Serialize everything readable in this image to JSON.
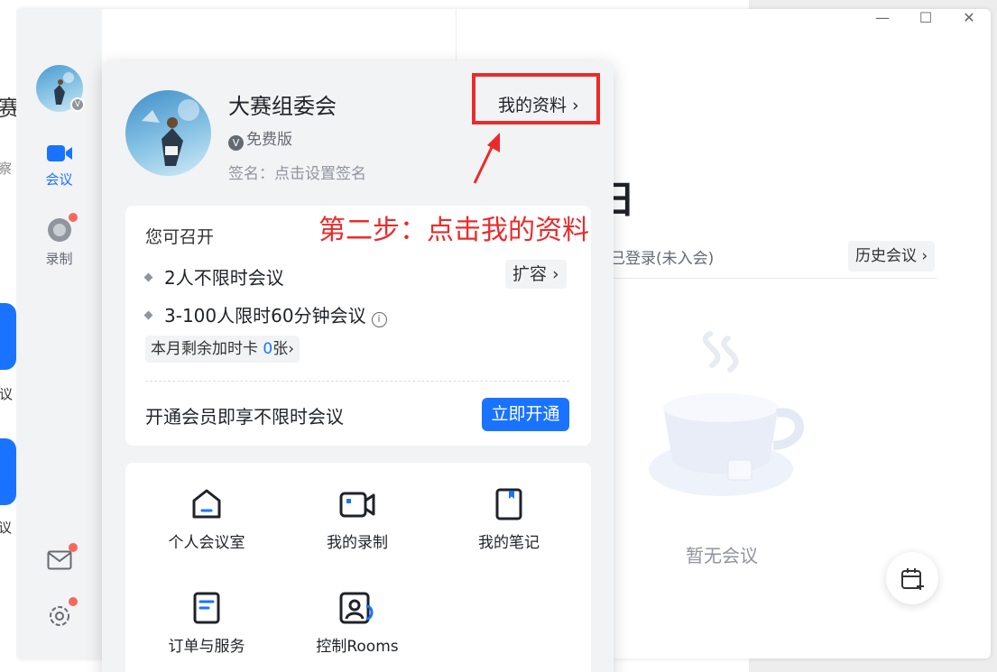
{
  "window": {
    "minimize_glyph": "—",
    "maximize_glyph": "☐",
    "close_glyph": "✕"
  },
  "left_edge": {
    "texts": [
      "赛",
      "察",
      "会议",
      "议"
    ]
  },
  "sidebar": {
    "items": [
      {
        "label": "会议",
        "icon": "video-camera-icon",
        "active": true
      },
      {
        "label": "录制",
        "icon": "record-icon",
        "active": false
      }
    ],
    "bottom_icons": [
      "mail-icon",
      "settings-gear-icon"
    ],
    "accent_color": "#1a73ff",
    "dot_color": "#f7685b"
  },
  "main": {
    "day_label": "日",
    "login_status": "已登录(未入会)",
    "history_button": "历史会议",
    "empty_text": "暂无会议"
  },
  "profile": {
    "name": "大赛组委会",
    "plan": "免费版",
    "signature": "签名：点击设置签名",
    "my_profile_link": "我的资料"
  },
  "benefits": {
    "title": "您可召开",
    "row1": "2人不限时会议",
    "row2": "3-100人限时60分钟会议",
    "expand_button": "扩容",
    "card_prefix": "本月剩余加时卡",
    "card_count": "0",
    "card_suffix": "张",
    "member_text": "开通会员即享不限时会议",
    "open_button": "立即开通"
  },
  "shortcuts": [
    {
      "label": "个人会议室",
      "icon": "personal-room-icon"
    },
    {
      "label": "我的录制",
      "icon": "recording-icon"
    },
    {
      "label": "我的笔记",
      "icon": "notes-icon"
    },
    {
      "label": "订单与服务",
      "icon": "orders-icon"
    },
    {
      "label": "控制Rooms",
      "icon": "rooms-control-icon"
    }
  ],
  "annotation": {
    "text": "第二步：点击我的资料",
    "color": "#ea2b2b"
  }
}
